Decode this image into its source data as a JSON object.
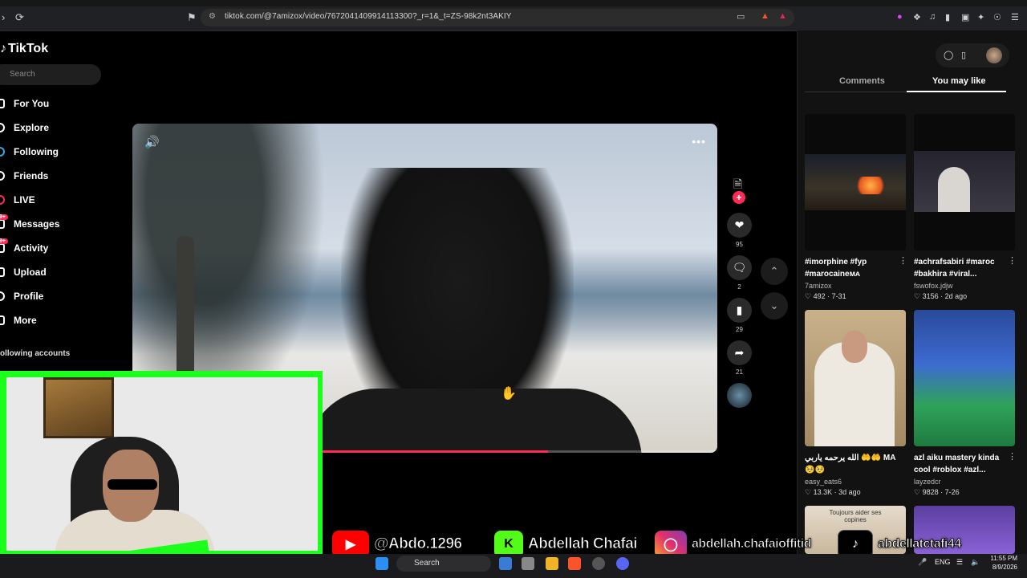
{
  "browser": {
    "url": "tiktok.com/@7amizox/video/7672041409914113300?_r=1&_t=ZS-98k2nt3AKIY"
  },
  "tiktok": {
    "logo": "TikTok",
    "search_placeholder": "Search",
    "nav": [
      {
        "label": "For You",
        "icon": "home-icon"
      },
      {
        "label": "Explore",
        "icon": "compass-icon"
      },
      {
        "label": "Following",
        "icon": "following-icon"
      },
      {
        "label": "Friends",
        "icon": "friends-icon"
      },
      {
        "label": "LIVE",
        "icon": "live-icon"
      },
      {
        "label": "Messages",
        "icon": "message-icon",
        "badge": "9+"
      },
      {
        "label": "Activity",
        "icon": "activity-icon",
        "badge": "9+"
      },
      {
        "label": "Upload",
        "icon": "upload-icon"
      },
      {
        "label": "Profile",
        "icon": "profile-icon"
      },
      {
        "label": "More",
        "icon": "more-icon"
      }
    ],
    "following_accounts_label": "ollowing accounts"
  },
  "video": {
    "progress_percent": 71,
    "actions": {
      "likes": "95",
      "comments": "2",
      "saves": "29",
      "shares": "21"
    }
  },
  "panel": {
    "tabs": [
      "Comments",
      "You may like"
    ],
    "active_tab": "You may like",
    "cards": [
      {
        "title": "#imorphine #fyp #marocaineᴍᴀ",
        "author": "7amizox",
        "likes": "492",
        "date": "7-31"
      },
      {
        "title": "#achrafsabiri #maroc #bakhira #viral...",
        "author": "fswofox.jdjw",
        "likes": "3156",
        "date": "2d ago"
      },
      {
        "title": "الله يرحمه ياربي 🤲🤲 MA 🥺🥺",
        "author": "easy_eats6",
        "likes": "13.3K",
        "date": "3d ago"
      },
      {
        "title": "azl aiku mastery kinda cool #roblox #azl...",
        "author": "layzedcr",
        "likes": "9828",
        "date": "7-26"
      }
    ],
    "bottom_thumb_caption": "Toujours aider ses copines"
  },
  "overlay": {
    "youtube": "@Abdo.1296",
    "kick": "Abdellah Chafai",
    "instagram": "abdellah.chafaioffitid",
    "tiktok": "abdellatctafi44"
  },
  "taskbar": {
    "search": "Search",
    "lang": "ENG",
    "time": "11:55 PM",
    "date": "8/9/2026"
  }
}
